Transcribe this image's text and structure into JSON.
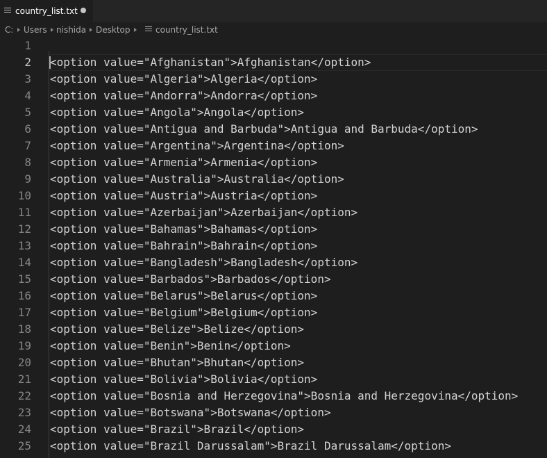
{
  "tab": {
    "label": "country_list.txt",
    "file_icon": "text-file-icon",
    "dirty_icon": "unsaved-dot-icon"
  },
  "breadcrumb": {
    "items": [
      "C:",
      "Users",
      "nishida",
      "Desktop",
      "country_list.txt"
    ],
    "separator_icon": "chevron-right-icon"
  },
  "editor": {
    "current_line": 2,
    "lines": [
      {
        "n": "1",
        "text": ""
      },
      {
        "n": "2",
        "text": "<option value=\"Afghanistan\">Afghanistan</option>"
      },
      {
        "n": "3",
        "text": "<option value=\"Algeria\">Algeria</option>"
      },
      {
        "n": "4",
        "text": "<option value=\"Andorra\">Andorra</option>"
      },
      {
        "n": "5",
        "text": "<option value=\"Angola\">Angola</option>"
      },
      {
        "n": "6",
        "text": "<option value=\"Antigua and Barbuda\">Antigua and Barbuda</option>"
      },
      {
        "n": "7",
        "text": "<option value=\"Argentina\">Argentina</option>"
      },
      {
        "n": "8",
        "text": "<option value=\"Armenia\">Armenia</option>"
      },
      {
        "n": "9",
        "text": "<option value=\"Australia\">Australia</option>"
      },
      {
        "n": "10",
        "text": "<option value=\"Austria\">Austria</option>"
      },
      {
        "n": "11",
        "text": "<option value=\"Azerbaijan\">Azerbaijan</option>"
      },
      {
        "n": "12",
        "text": "<option value=\"Bahamas\">Bahamas</option>"
      },
      {
        "n": "13",
        "text": "<option value=\"Bahrain\">Bahrain</option>"
      },
      {
        "n": "14",
        "text": "<option value=\"Bangladesh\">Bangladesh</option>"
      },
      {
        "n": "15",
        "text": "<option value=\"Barbados\">Barbados</option>"
      },
      {
        "n": "16",
        "text": "<option value=\"Belarus\">Belarus</option>"
      },
      {
        "n": "17",
        "text": "<option value=\"Belgium\">Belgium</option>"
      },
      {
        "n": "18",
        "text": "<option value=\"Belize\">Belize</option>"
      },
      {
        "n": "19",
        "text": "<option value=\"Benin\">Benin</option>"
      },
      {
        "n": "20",
        "text": "<option value=\"Bhutan\">Bhutan</option>"
      },
      {
        "n": "21",
        "text": "<option value=\"Bolivia\">Bolivia</option>"
      },
      {
        "n": "22",
        "text": "<option value=\"Bosnia and Herzegovina\">Bosnia and Herzegovina</option>"
      },
      {
        "n": "23",
        "text": "<option value=\"Botswana\">Botswana</option>"
      },
      {
        "n": "24",
        "text": "<option value=\"Brazil\">Brazil</option>"
      },
      {
        "n": "25",
        "text": "<option value=\"Brazil Darussalam\">Brazil Darussalam</option>"
      }
    ]
  }
}
